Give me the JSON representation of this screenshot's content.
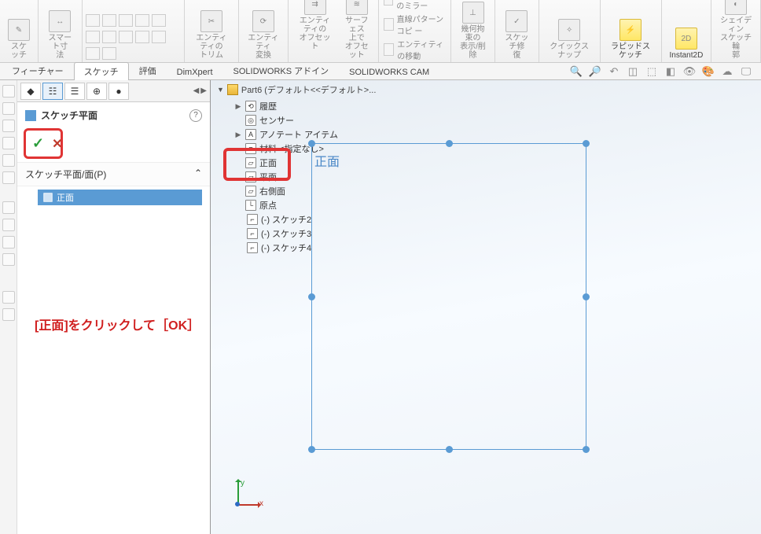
{
  "ribbon": {
    "sketch": "スケッチ",
    "smart_dim": "スマート寸\n法",
    "entity_trim": "エンティティの\nトリム",
    "entity_convert": "エンティティ\n変換",
    "entity_offset": "エンティティの\nオフセット",
    "surface_offset": "サーフェス\n上で\nオフセット",
    "mirror": "エンティティのミラー",
    "linear_pattern": "直線パターン コピ\nー",
    "move_entity": "エンティティの移動",
    "geom_constraint": "幾何拘束の\n表示/削除",
    "repair": "スケッチ修\n復",
    "quick_snap": "クイックスナップ",
    "rapid_sketch": "ラピッドスケッチ",
    "instant2d": "Instant2D",
    "shading": "シェイディン\nスケッチ輪\n郭"
  },
  "tabs": {
    "features": "フィーチャー",
    "sketch": "スケッチ",
    "evaluate": "評価",
    "dimxpert": "DimXpert",
    "addins": "SOLIDWORKS アドイン",
    "cam": "SOLIDWORKS CAM"
  },
  "panel": {
    "title": "スケッチ平面",
    "section": "スケッチ平面/面(P)",
    "selected": "正面"
  },
  "tree": {
    "root": "Part6 (デフォルト<<デフォルト>...",
    "history": "履歴",
    "sensors": "センサー",
    "annotations": "アノテート アイテム",
    "material": "材料 <指定なし>",
    "front": "正面",
    "top": "平面",
    "right": "右側面",
    "origin": "原点",
    "sk2": "(-) スケッチ2",
    "sk3": "(-) スケッチ3",
    "sk4": "(-) スケッチ4"
  },
  "viewport": {
    "plane_overlay": "正面"
  },
  "triad": {
    "x": "x",
    "y": "y"
  },
  "annotation": "[正面]をクリックして［OK］"
}
